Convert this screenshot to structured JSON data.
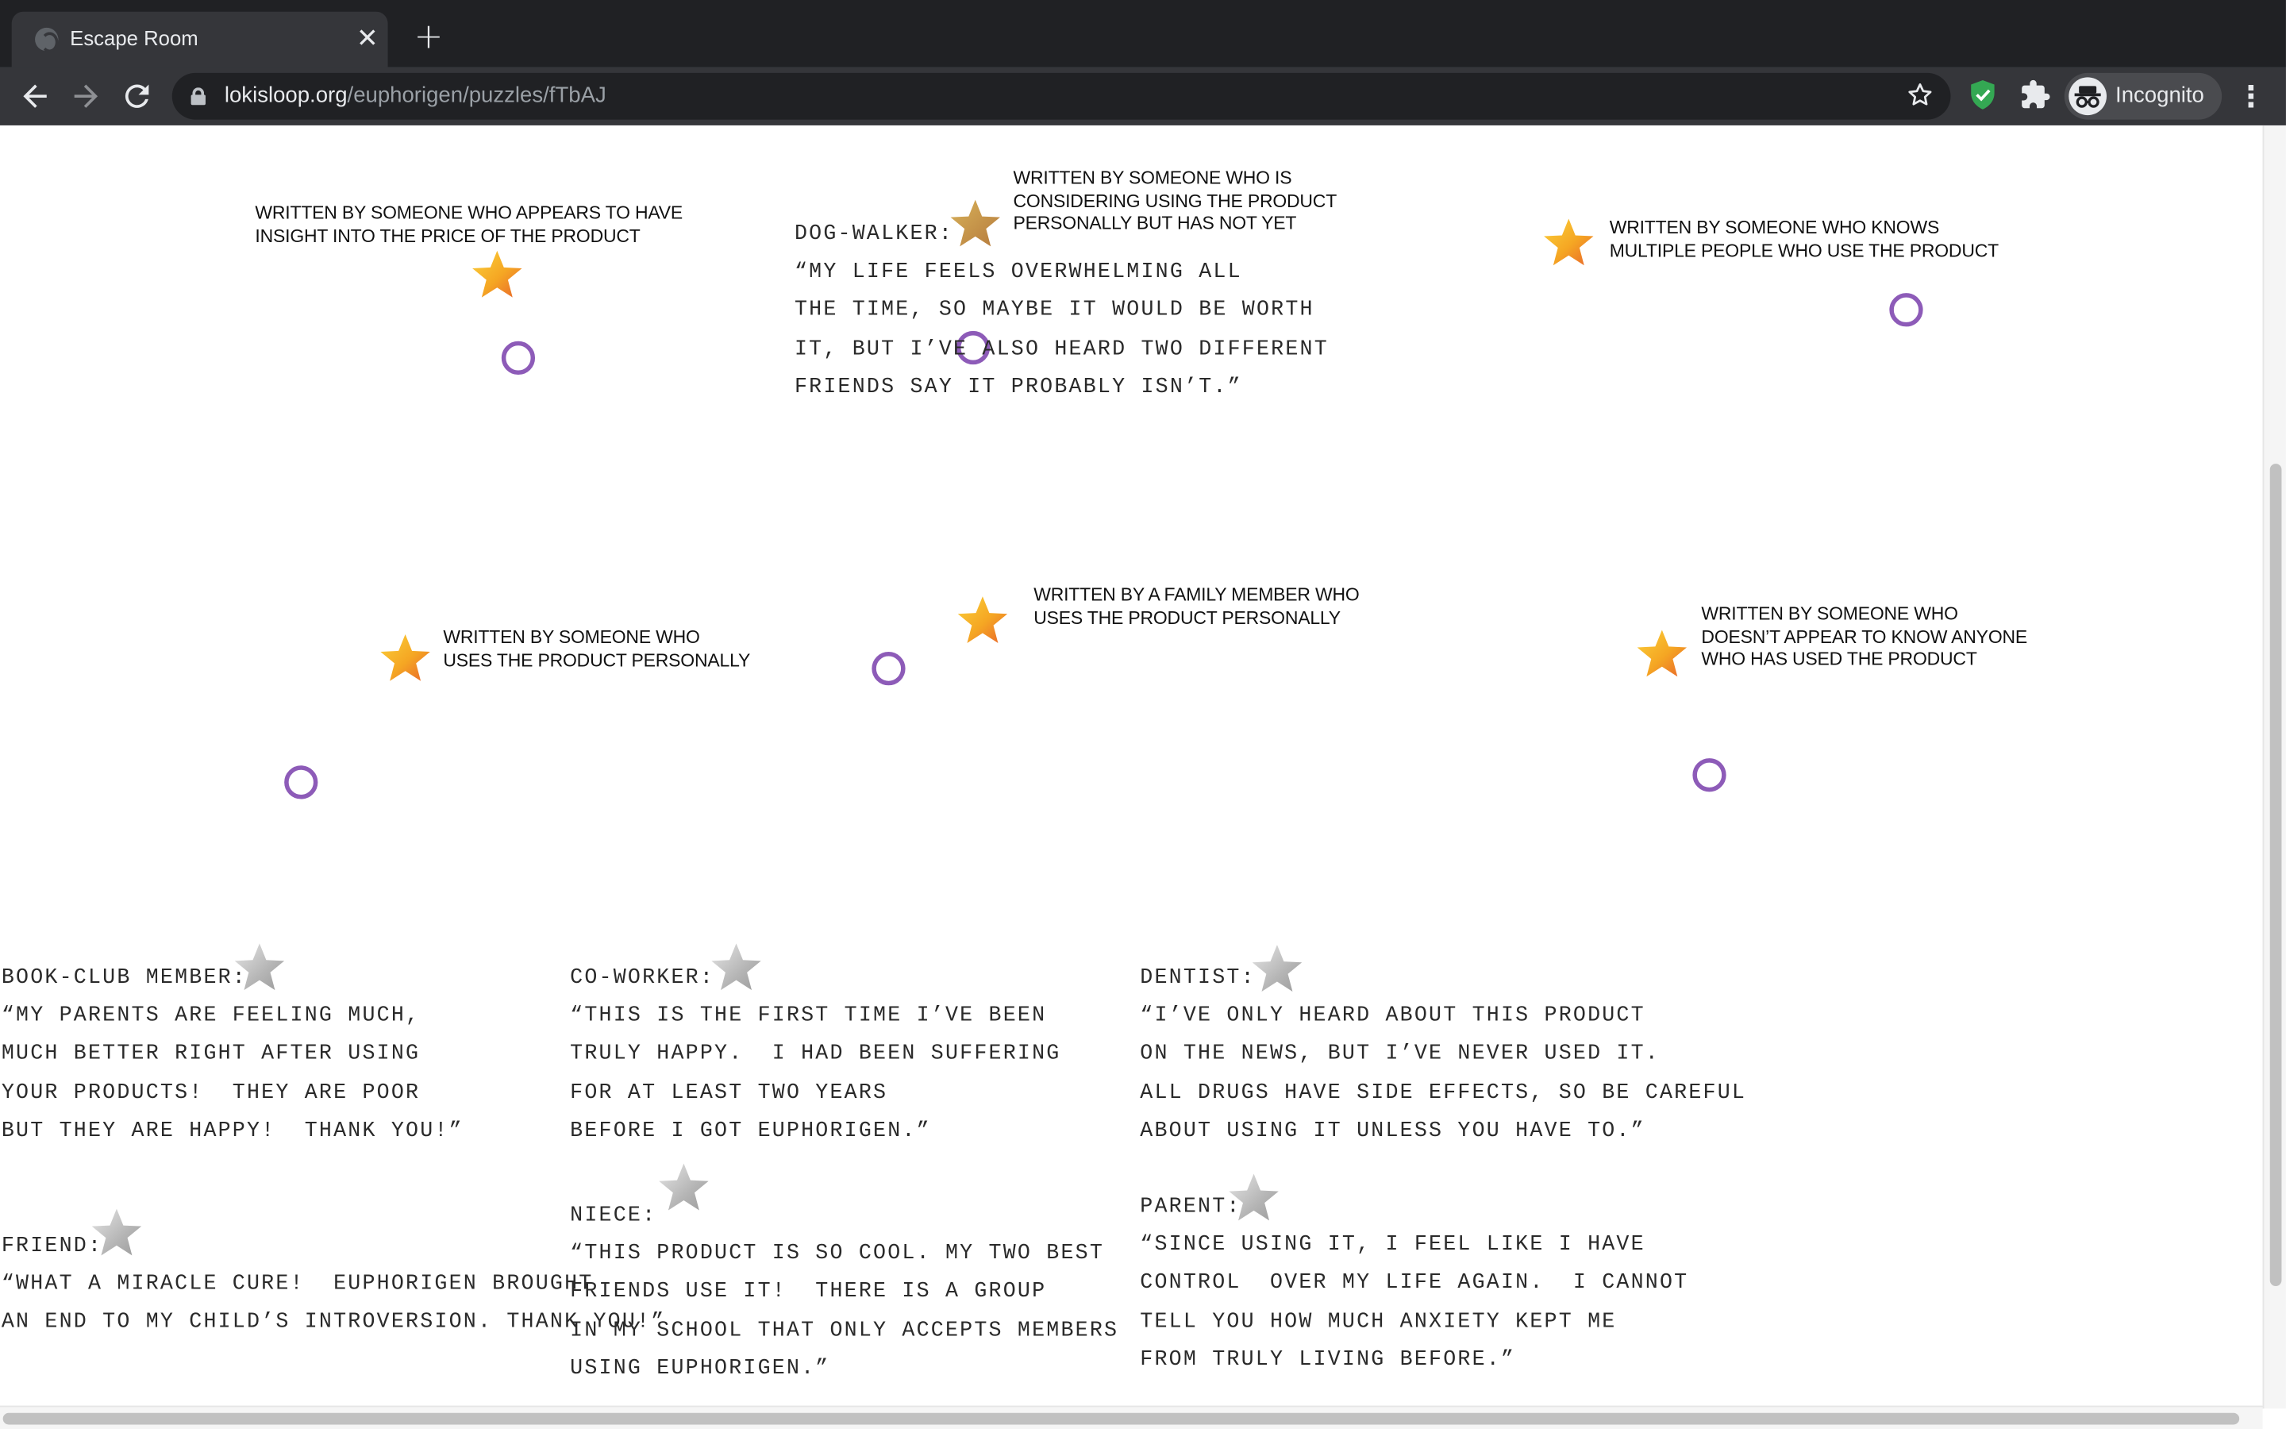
{
  "browser": {
    "tab_title": "Escape Room",
    "tab_close": "✕",
    "new_tab": "+",
    "url_host": "lokisloop.org",
    "url_path": "/euphorigen/puzzles/fTbAJ",
    "profile_label": "Incognito"
  },
  "criteria": [
    "WRITTEN BY SOMEONE WHO APPEARS TO HAVE\nINSIGHT INTO THE PRICE OF THE PRODUCT",
    "WRITTEN BY SOMEONE WHO IS\nCONSIDERING USING THE PRODUCT\nPERSONALLY BUT HAS NOT YET",
    "WRITTEN BY SOMEONE WHO KNOWS\nMULTIPLE PEOPLE WHO USE THE PRODUCT",
    "WRITTEN BY SOMEONE WHO\nUSES THE PRODUCT PERSONALLY",
    "WRITTEN BY A FAMILY MEMBER WHO\nUSES THE PRODUCT PERSONALLY",
    "WRITTEN BY SOMEONE WHO\nDOESN’T APPEAR TO KNOW ANYONE\nWHO HAS USED THE PRODUCT"
  ],
  "testimonials": {
    "dog_walker": "DOG-WALKER:\n“MY LIFE FEELS OVERWHELMING ALL\nTHE TIME, SO MAYBE IT WOULD BE WORTH\nIT, BUT I’VE ALSO HEARD TWO DIFFERENT\nFRIENDS SAY IT PROBABLY ISN’T.”",
    "book_club_member": "BOOK-CLUB MEMBER:\n“MY PARENTS ARE FEELING MUCH,\nMUCH BETTER RIGHT AFTER USING\nYOUR PRODUCTS!  THEY ARE POOR\nBUT THEY ARE HAPPY!  THANK YOU!”",
    "co_worker": "CO-WORKER:\n“THIS IS THE FIRST TIME I’VE BEEN\nTRULY HAPPY.  I HAD BEEN SUFFERING\nFOR AT LEAST TWO YEARS\nBEFORE I GOT EUPHORIGEN.”",
    "dentist": "DENTIST:\n“I’VE ONLY HEARD ABOUT THIS PRODUCT\nON THE NEWS, BUT I’VE NEVER USED IT.\nALL DRUGS HAVE SIDE EFFECTS, SO BE CAREFUL\nABOUT USING IT UNLESS YOU HAVE TO.”",
    "friend": "FRIEND:\n“WHAT A MIRACLE CURE!  EUPHORIGEN BROUGHT\nAN END TO MY CHILD’S INTROVERSION. THANK YOU!”",
    "niece": "NIECE:\n“THIS PRODUCT IS SO COOL. MY TWO BEST\nFRIENDS USE IT!  THERE IS A GROUP\nIN MY SCHOOL THAT ONLY ACCEPTS MEMBERS\nUSING EUPHORIGEN.”",
    "parent": "PARENT:\n“SINCE USING IT, I FEEL LIKE I HAVE\nCONTROL  OVER MY LIFE AGAIN.  I CANNOT\nTELL YOU HOW MUCH ANXIETY KEPT ME\nFROM TRULY LIVING BEFORE.”"
  },
  "colors": {
    "chrome_dark": "#202124",
    "toolbar": "#35363a",
    "target_circle": "#8d5bb8",
    "star_gold": "#f5a623",
    "star_grey": "#b8b8b8",
    "shield_green": "#34a853"
  },
  "icons": [
    "globe-icon",
    "close-icon",
    "plus-icon",
    "back-arrow-icon",
    "forward-arrow-icon",
    "reload-icon",
    "lock-icon",
    "star-outline-icon",
    "shield-check-icon",
    "puzzle-icon",
    "incognito-icon",
    "kebab-menu-icon"
  ]
}
